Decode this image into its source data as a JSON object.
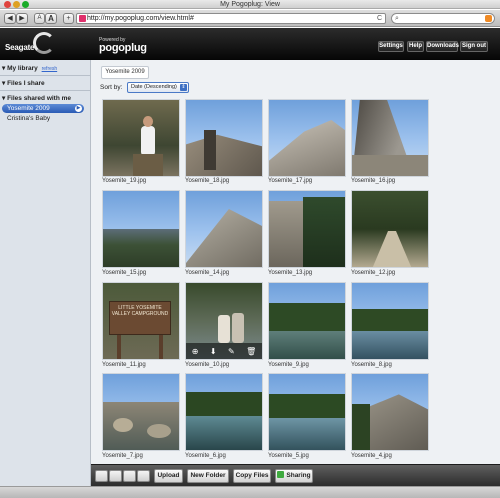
{
  "window": {
    "title": "My Pogoplug: View"
  },
  "browser": {
    "url": "http://my.pogoplug.com/view.html#",
    "back_label": "◀",
    "forward_label": "▶",
    "text_smaller_label": "A",
    "text_larger_label": "A",
    "add_label": "+",
    "reload_label": "C",
    "search_placeholder": ""
  },
  "header": {
    "brand": "Seagate",
    "powered_by": "Powered by",
    "pogo_logo": "pogoplug",
    "buttons": {
      "settings": "Settings",
      "help": "Help",
      "downloads": "Downloads",
      "signout": "Sign out"
    }
  },
  "sidebar": {
    "my_library": "My library",
    "refresh": "refresh",
    "files_i_share": "Files I share",
    "files_shared_with_me": "Files shared with me",
    "items": [
      "Yosemite 2009",
      "Cristina's Baby"
    ]
  },
  "main": {
    "tab": "Yosemite 2009",
    "sort_label": "Sort by:",
    "sort_value": "Date (Descending)",
    "photos": [
      "Yosemite_19.jpg",
      "Yosemite_18.jpg",
      "Yosemite_17.jpg",
      "Yosemite_16.jpg",
      "Yosemite_15.jpg",
      "Yosemite_14.jpg",
      "Yosemite_13.jpg",
      "Yosemite_12.jpg",
      "Yosemite_11.jpg",
      "Yosemite_10.jpg",
      "Yosemite_9.jpg",
      "Yosemite_8.jpg",
      "Yosemite_7.jpg",
      "Yosemite_6.jpg",
      "Yosemite_5.jpg",
      "Yosemite_4.jpg"
    ],
    "sign_text": "LITTLE YOSEMITE VALLEY CAMPGROUND"
  },
  "bottombar": {
    "upload": "Upload",
    "new_folder": "New Folder",
    "copy_files": "Copy Files",
    "sharing": "Sharing"
  },
  "colors": {
    "accent": "#2a5bb5",
    "header_bg": "#0b0b0b",
    "pogo_accent": "#e0306c"
  }
}
